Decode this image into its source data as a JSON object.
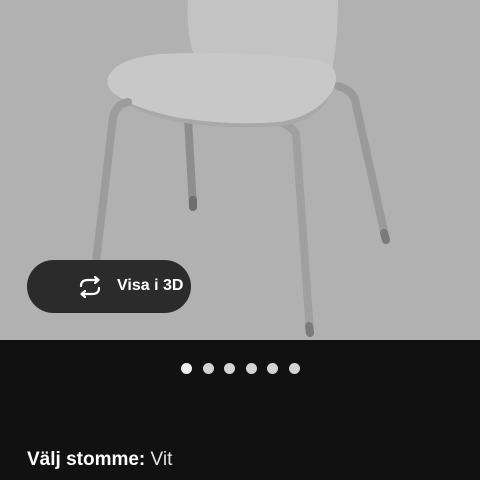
{
  "product": {
    "image": "chair-product-image",
    "view_3d_label": "Visa i 3D",
    "view_3d_icon": "rotate-arrows-icon"
  },
  "carousel": {
    "total": 6,
    "current": 1
  },
  "options": {
    "frame_label": "Välj stomme:",
    "frame_value": "Vit"
  },
  "colors": {
    "image_background": "#b1b1b1",
    "panel_background": "#111111",
    "button_background": "#2b2b2b",
    "text_primary": "#ffffff"
  }
}
